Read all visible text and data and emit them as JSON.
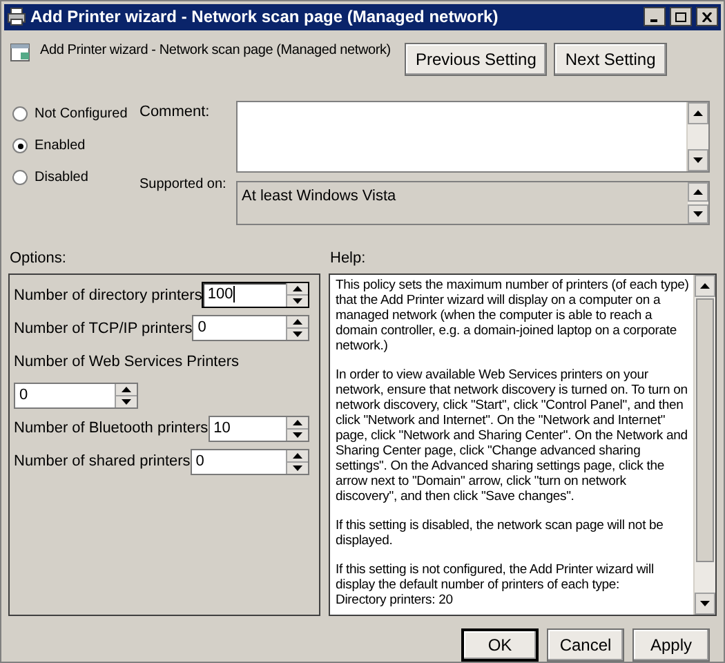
{
  "window": {
    "title": "Add Printer wizard - Network scan page (Managed network)"
  },
  "header": {
    "policy_name": "Add Printer wizard - Network scan page (Managed network)",
    "buttons": [
      "Previous Setting",
      "Next Setting"
    ]
  },
  "state_options": [
    {
      "label": "Not Configured",
      "selected": false
    },
    {
      "label": "Enabled",
      "selected": true
    },
    {
      "label": "Disabled",
      "selected": false
    }
  ],
  "comment": {
    "label": "Comment:"
  },
  "supported_on": {
    "label": "Supported on:",
    "value": "At least Windows Vista"
  },
  "options": {
    "label": "Options:",
    "items": [
      {
        "kind": "inline",
        "label": "Number of directory printers",
        "value": "100",
        "focused": true
      },
      {
        "kind": "inline",
        "label": "Number of TCP/IP printers",
        "value": "0",
        "focused": false
      },
      {
        "kind": "stacked",
        "label": "Number of Web Services Printers",
        "value": "0",
        "focused": false
      },
      {
        "kind": "inline",
        "label": "Number of Bluetooth printers",
        "value": "10",
        "focused": false
      },
      {
        "kind": "inline",
        "label": "Number of shared printers",
        "value": "0",
        "focused": false
      }
    ]
  },
  "help": {
    "label": "Help:",
    "paragraphs": [
      [
        "This policy sets the maximum number of printers (of each type) that the Add Printer wizard will display on a computer on a managed network (when the computer is able to reach a domain controller, e.g. a domain-joined laptop on a corporate network.)"
      ],
      [
        "In order to view available Web Services printers on your network, ensure that network discovery is turned on. To turn on network discovery, click \"Start\", click \"Control Panel\", and then click \"Network and Internet\". On the \"Network and Internet\" page, click \"Network and Sharing Center\". On the Network and Sharing Center page, click \"Change advanced sharing settings\". On the Advanced sharing settings page, click the arrow next to \"Domain\" arrow, click \"turn on network discovery\", and then click \"Save changes\"."
      ],
      [
        "If this setting is disabled, the network scan page will not be displayed."
      ],
      [
        "If this setting is not configured, the Add Printer wizard will display the default number of printers of each type:",
        "Directory printers: 20"
      ]
    ]
  },
  "footer": {
    "buttons": [
      {
        "label": "OK",
        "default": true
      },
      {
        "label": "Cancel",
        "default": false
      },
      {
        "label": "Apply",
        "default": false
      }
    ]
  }
}
